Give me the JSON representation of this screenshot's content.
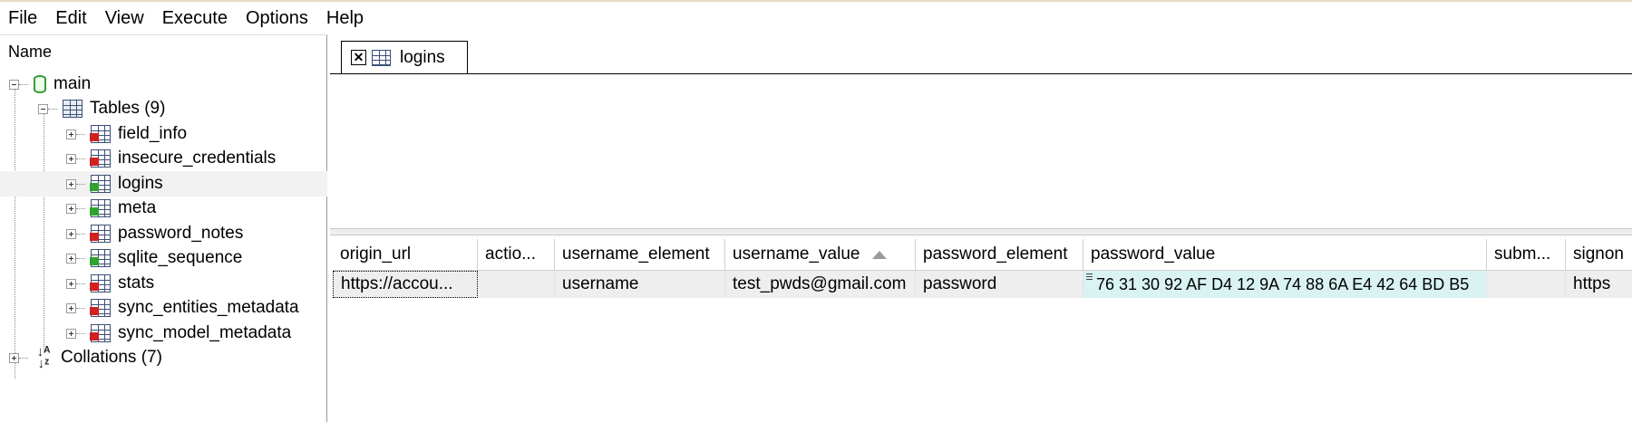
{
  "menu": {
    "items": [
      "File",
      "Edit",
      "View",
      "Execute",
      "Options",
      "Help"
    ]
  },
  "tree": {
    "header": "Name",
    "root": "main",
    "tables_group": "Tables (9)",
    "tables": [
      "field_info",
      "insecure_credentials",
      "logins",
      "meta",
      "password_notes",
      "sqlite_sequence",
      "stats",
      "sync_entities_metadata",
      "sync_model_metadata"
    ],
    "collations": "Collations (7)"
  },
  "tab": {
    "close_glyph": "✕",
    "label": "logins"
  },
  "grid": {
    "columns": [
      "origin_url",
      "actio...",
      "username_element",
      "username_value",
      "password_element",
      "password_value",
      "subm...",
      "signon"
    ],
    "sorted_column": "username_value",
    "rows": [
      [
        "https://accou...",
        "",
        "username",
        "test_pwds@gmail.com",
        "password",
        "76 31 30 92 AF D4 12 9A 74 88 6A E4 42 64 BD B5",
        "",
        "https"
      ]
    ]
  }
}
